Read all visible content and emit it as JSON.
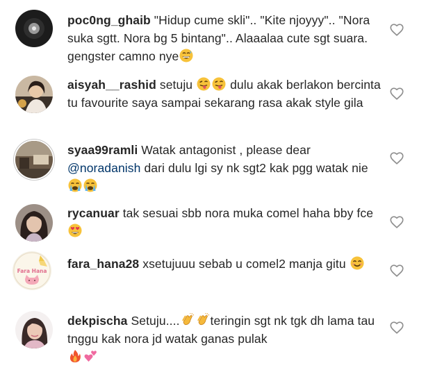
{
  "comments": [
    {
      "username": "poc0ng_ghaib",
      "text": "\"Hidup cume skli\".. \"Kite njoyyy\".. \"Nora suka sgtt. Nora bg 5 bintang\".. Alaaalaa cute sgt suara.  gengster camno nye",
      "emojis": [
        "grinning-sweat-emoji"
      ]
    },
    {
      "username": "aisyah__rashid",
      "text_before": "setuju",
      "emojis_mid": [
        "winking-tongue-emoji",
        "winking-tongue-emoji"
      ],
      "text_after": "dulu akak berlakon bercinta tu favourite saya sampai sekarang rasa akak style gila"
    },
    {
      "username": "syaa99ramli",
      "text_before": "Watak antagonist , please dear",
      "mention": "@noradanish",
      "text_after": "dari dulu lgi sy nk sgt2 kak pgg watak nie",
      "emojis": [
        "crying-face-emoji",
        "crying-face-emoji"
      ]
    },
    {
      "username": "rycanuar",
      "text": "tak sesuai sbb nora muka comel haha bby fce",
      "emojis": [
        "heart-eyes-emoji"
      ]
    },
    {
      "username": "fara_hana28",
      "text": "xsetujuuu sebab u comel2 manja gitu",
      "emojis": [
        "smiling-face-emoji"
      ],
      "avatar_caption": "Fara Hana"
    },
    {
      "username": "dekpischa",
      "text_before": "Setuju....",
      "emojis_mid": [
        "clapping-hands-emoji",
        "clapping-hands-emoji"
      ],
      "text_after": "teringin sgt nk tgk dh lama tau tnggu kak nora jd watak ganas pulak",
      "emojis": [
        "fire-emoji",
        "two-hearts-emoji"
      ]
    }
  ],
  "colors": {
    "text": "#262626",
    "mention": "#003569",
    "heart_outline": "#8e8e8e",
    "emoji_yellow": "#f7c23a"
  }
}
